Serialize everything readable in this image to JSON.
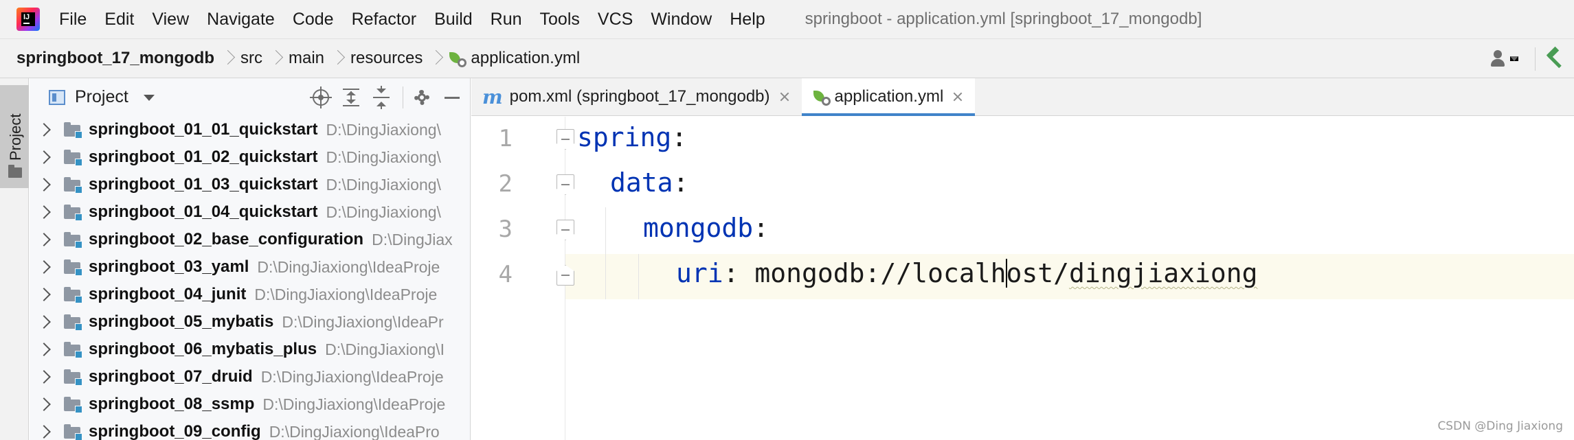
{
  "menubar": {
    "items": [
      "File",
      "Edit",
      "View",
      "Navigate",
      "Code",
      "Refactor",
      "Build",
      "Run",
      "Tools",
      "VCS",
      "Window",
      "Help"
    ],
    "window_title": "springboot - application.yml [springboot_17_mongodb]"
  },
  "breadcrumb": {
    "project": "springboot_17_mongodb",
    "dirs": [
      "src",
      "main",
      "resources"
    ],
    "file": "application.yml"
  },
  "project_panel": {
    "title": "Project",
    "tree": [
      {
        "name": "springboot_01_01_quickstart",
        "path": "D:\\DingJiaxiong\\"
      },
      {
        "name": "springboot_01_02_quickstart",
        "path": "D:\\DingJiaxiong\\"
      },
      {
        "name": "springboot_01_03_quickstart",
        "path": "D:\\DingJiaxiong\\"
      },
      {
        "name": "springboot_01_04_quickstart",
        "path": "D:\\DingJiaxiong\\"
      },
      {
        "name": "springboot_02_base_configuration",
        "path": "D:\\DingJiax"
      },
      {
        "name": "springboot_03_yaml",
        "path": "D:\\DingJiaxiong\\IdeaProje"
      },
      {
        "name": "springboot_04_junit",
        "path": "D:\\DingJiaxiong\\IdeaProje"
      },
      {
        "name": "springboot_05_mybatis",
        "path": "D:\\DingJiaxiong\\IdeaPr"
      },
      {
        "name": "springboot_06_mybatis_plus",
        "path": "D:\\DingJiaxiong\\I"
      },
      {
        "name": "springboot_07_druid",
        "path": "D:\\DingJiaxiong\\IdeaProje"
      },
      {
        "name": "springboot_08_ssmp",
        "path": "D:\\DingJiaxiong\\IdeaProje"
      },
      {
        "name": "springboot_09_config",
        "path": "D:\\DingJiaxiong\\IdeaPro"
      }
    ]
  },
  "tool_strip": {
    "project_tab": "Project"
  },
  "editor_tabs": [
    {
      "label": "pom.xml (springboot_17_mongodb)",
      "active": false
    },
    {
      "label": "application.yml",
      "active": true
    }
  ],
  "editor": {
    "line_numbers": [
      "1",
      "2",
      "3",
      "4"
    ],
    "lines": [
      {
        "key": "spring",
        "colon": ":",
        "value": ""
      },
      {
        "key": "data",
        "colon": ":",
        "value": ""
      },
      {
        "key": "mongodb",
        "colon": ":",
        "value": ""
      },
      {
        "key": "uri",
        "colon": ": ",
        "value_before_caret": "mongodb://localh",
        "value_after_caret": "ost/",
        "value_squiggle": "dingjiaxiong"
      }
    ]
  },
  "watermark": "CSDN @Ding Jiaxiong",
  "colors": {
    "keyword": "#0033b3",
    "active_tab_underline": "#4083c9",
    "current_line": "#fcfaed",
    "spring_green": "#6db33f"
  }
}
